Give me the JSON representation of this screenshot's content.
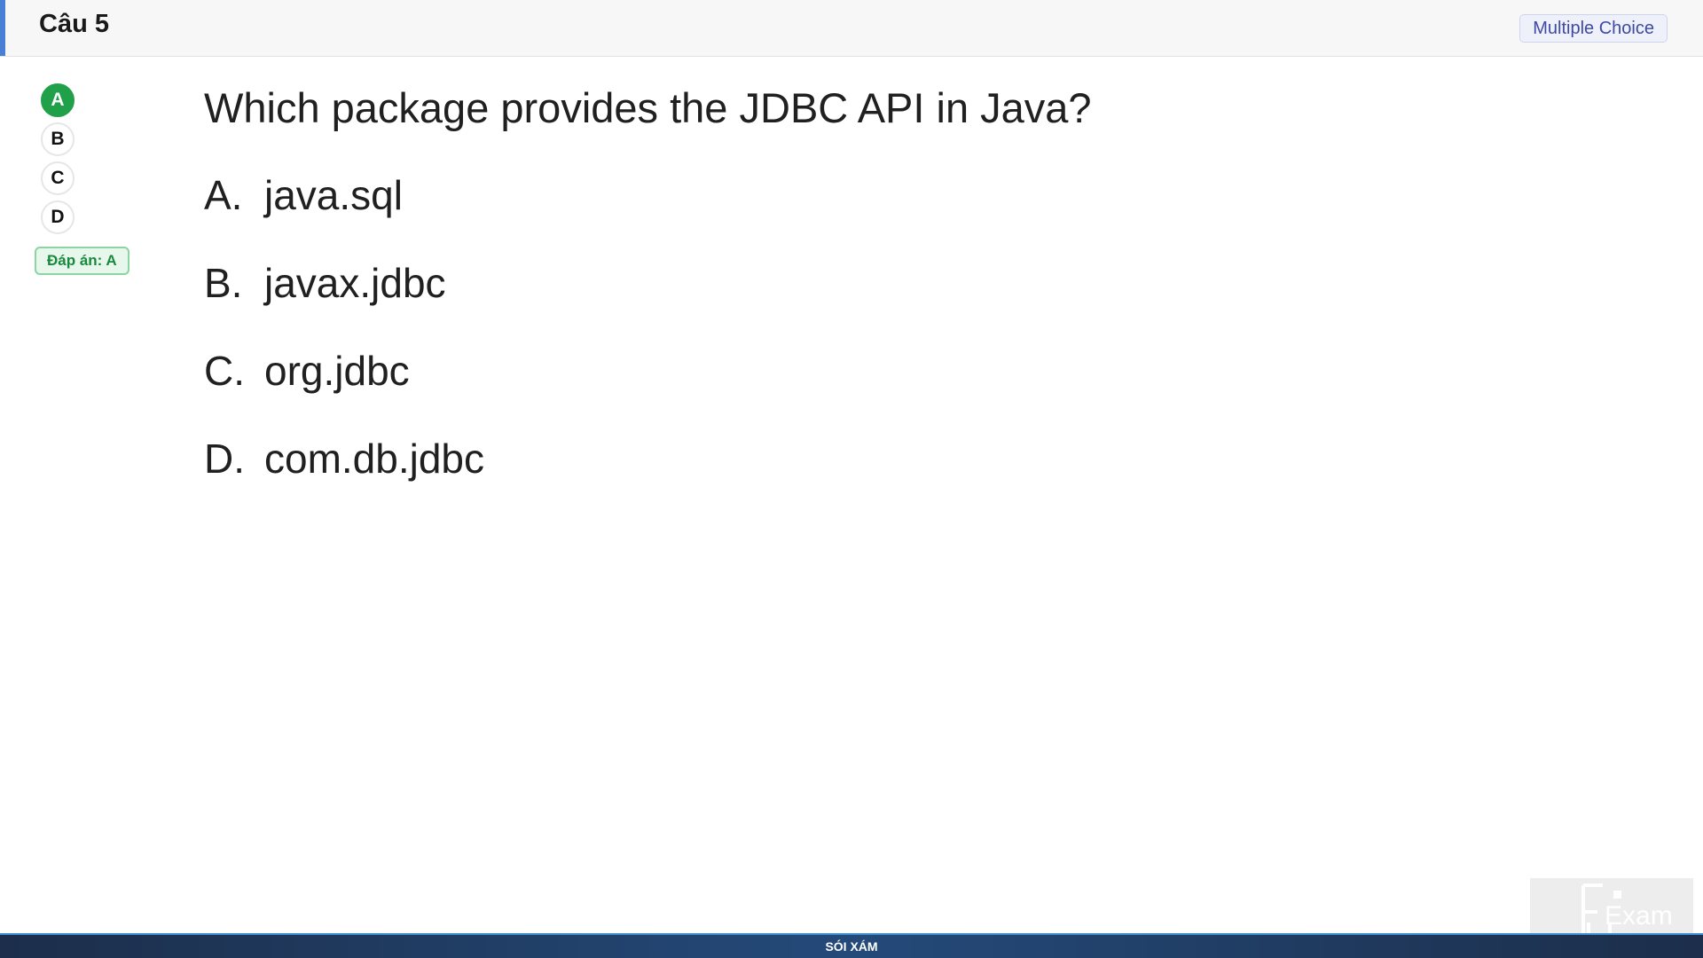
{
  "header": {
    "title": "Câu 5",
    "type_badge": "Multiple Choice"
  },
  "options_nav": [
    {
      "label": "A",
      "selected": true
    },
    {
      "label": "B",
      "selected": false
    },
    {
      "label": "C",
      "selected": false
    },
    {
      "label": "D",
      "selected": false
    }
  ],
  "answer_badge": "Đáp án: A",
  "question": {
    "text": "Which package provides the JDBC API in Java?",
    "answers": [
      {
        "letter": "A.",
        "text": "java.sql"
      },
      {
        "letter": "B.",
        "text": "javax.jdbc"
      },
      {
        "letter": "C.",
        "text": "org.jdbc"
      },
      {
        "letter": "D.",
        "text": "com.db.jdbc"
      }
    ]
  },
  "footer": {
    "text": "SÓI XÁM"
  },
  "logo": {
    "text": "Exam",
    "icon": "fu-exam-logo"
  },
  "colors": {
    "accent": "#4a7fd6",
    "correct": "#21a04a",
    "footer": "#1c2e4a"
  }
}
